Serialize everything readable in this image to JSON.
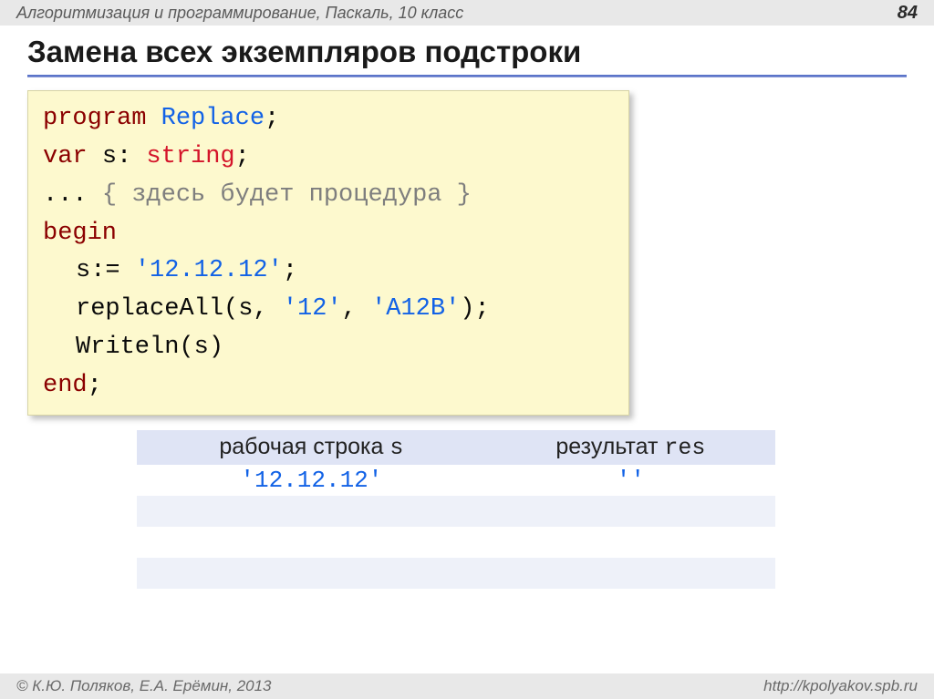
{
  "header": {
    "course": "Алгоритмизация и программирование, Паскаль, 10 класс",
    "page": "84"
  },
  "title": "Замена всех экземпляров подстроки",
  "code": {
    "l1_kw": "program",
    "l1_id": "Replace",
    "l1_end": ";",
    "l2_kw": "var",
    "l2_var": "s:",
    "l2_type": "string",
    "l2_end": ";",
    "l3_dots": "... ",
    "l3_comment": "{ здесь будет процедура }",
    "l4": "begin",
    "l5_a": "s:= ",
    "l5_s": "'12.12.12'",
    "l5_b": ";",
    "l6_a": "replaceAll",
    "l6_b": "(s, ",
    "l6_s1": "'12'",
    "l6_c": ", ",
    "l6_s2": "'A12B'",
    "l6_d": ");",
    "l7_a": "Writeln",
    "l7_b": "(s)",
    "l8_kw": "end",
    "l8_end": ";"
  },
  "table": {
    "col1_label_a": "рабочая строка ",
    "col1_label_b": "s",
    "col2_label_a": "результат ",
    "col2_label_b": "res",
    "r1_s": "'12.12.12'",
    "r1_res": "''"
  },
  "footer": {
    "authors": "© К.Ю. Поляков, Е.А. Ерёмин, 2013",
    "url": "http://kpolyakov.spb.ru"
  }
}
